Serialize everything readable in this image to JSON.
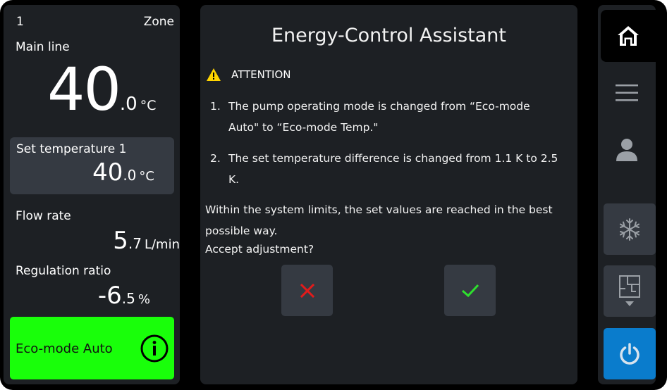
{
  "zone": {
    "number": "1",
    "label": "Zone"
  },
  "main_line": {
    "label": "Main line",
    "int": "40",
    "dec": ".0",
    "unit": "°C"
  },
  "set_temperature": {
    "label": "Set temperature 1",
    "int": "40",
    "dec": ".0",
    "unit": "°C"
  },
  "flow_rate": {
    "label": "Flow rate",
    "int": "5",
    "dec": ".7",
    "unit": "L/min"
  },
  "regulation_ratio": {
    "label": "Regulation ratio",
    "int": "-6",
    "dec": ".5",
    "unit": "%"
  },
  "eco_mode": {
    "label": "Eco-mode Auto",
    "color": "#19ff0a"
  },
  "dialog": {
    "title": "Energy-Control Assistant",
    "attention": "ATTENTION",
    "items": [
      {
        "num": "1.",
        "line1": "The pump operating mode is changed from “Eco-mode",
        "line2": "Auto\" to “Eco-mode Temp.\""
      },
      {
        "num": "2.",
        "line1": "The set temperature difference is changed from 1.1 K to 2.5 K."
      }
    ],
    "body_line1": "Within the system limits, the set values are reached in the best",
    "body_line2": "possible way.",
    "question": "Accept adjustment?"
  },
  "colors": {
    "cancel": "#e21b1b",
    "confirm": "#2ee02e",
    "warning": "#ffd400",
    "power": "#0a7ccc"
  },
  "nav": {
    "items": [
      "home-icon",
      "menu-icon",
      "user-icon",
      "snowflake-icon",
      "floor-plan-icon",
      "power-icon"
    ]
  }
}
